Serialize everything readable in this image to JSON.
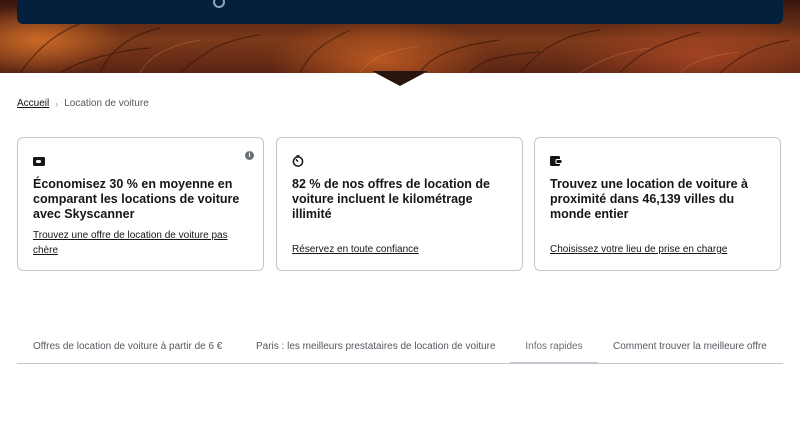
{
  "breadcrumb": {
    "home": "Accueil",
    "current": "Location de voiture"
  },
  "cards": [
    {
      "icon": "wallet-icon",
      "title": "Économisez 30 % en moyenne en comparant les locations de voiture avec Skyscanner",
      "link": "Trouvez une offre de location de voiture pas chère"
    },
    {
      "icon": "stopwatch-icon",
      "title": "82 % de nos offres de location de voiture incluent le kilométrage illimité",
      "link": "Réservez en toute confiance"
    },
    {
      "icon": "purse-icon",
      "title": "Trouvez une location de voiture à proximité dans 46,139 villes du monde entier",
      "link": "Choisissez votre lieu de prise en charge"
    }
  ],
  "info_icon": "i",
  "tabs": [
    {
      "label": "Offres de location de voiture à partir de 6 €",
      "active": false
    },
    {
      "label": "Paris : les meilleurs prestataires de location de voiture",
      "active": false
    },
    {
      "label": "Infos rapides",
      "active": true
    },
    {
      "label": "Comment trouver la meilleure offre",
      "active": false
    }
  ],
  "colors": {
    "hero_card": "#05203c",
    "border": "#c1c7cf",
    "text": "#161616"
  }
}
